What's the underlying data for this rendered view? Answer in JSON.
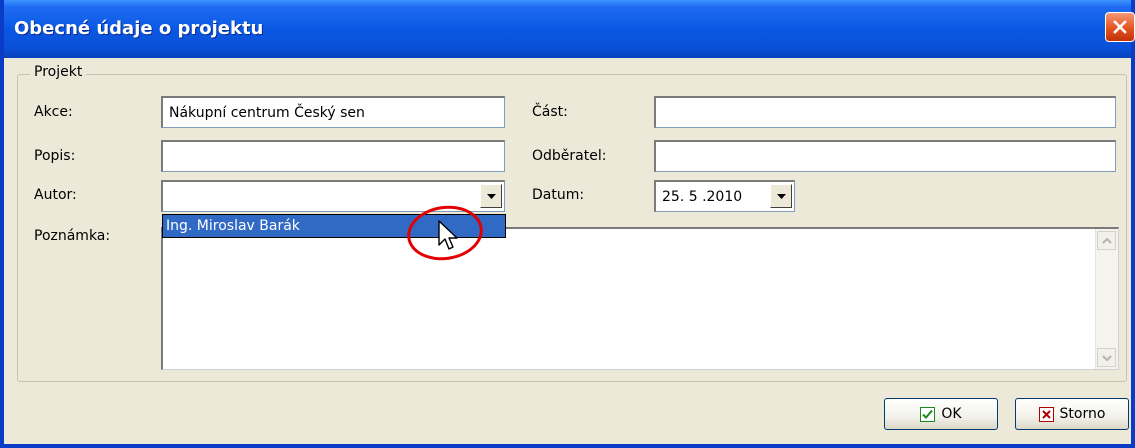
{
  "window": {
    "title": "Obecné údaje o projektu"
  },
  "group": {
    "legend": "Projekt"
  },
  "fields": {
    "akce": {
      "label": "Akce:",
      "value": "Nákupní centrum Český sen"
    },
    "popis": {
      "label": "Popis:",
      "value": ""
    },
    "autor": {
      "label": "Autor:",
      "value": ""
    },
    "poznamka": {
      "label": "Poznámka:",
      "value": ""
    },
    "cast": {
      "label": "Část:",
      "value": ""
    },
    "odberatel": {
      "label": "Odběratel:",
      "value": ""
    },
    "datum": {
      "label": "Datum:",
      "value": "25. 5 .2010"
    }
  },
  "autor_dropdown": {
    "options": [
      "Ing. Miroslav Barák"
    ],
    "highlighted": "Ing. Miroslav Barák"
  },
  "buttons": {
    "ok": "OK",
    "storno": "Storno"
  },
  "icons": {
    "close": "close-icon",
    "ok": "check-icon",
    "storno": "x-box-icon"
  },
  "colors": {
    "titlebar": "#0a58e4",
    "selection": "#316ac5",
    "annotation": "#e30000",
    "ok_icon": "#1c8a1c",
    "storno_icon": "#b00000"
  }
}
